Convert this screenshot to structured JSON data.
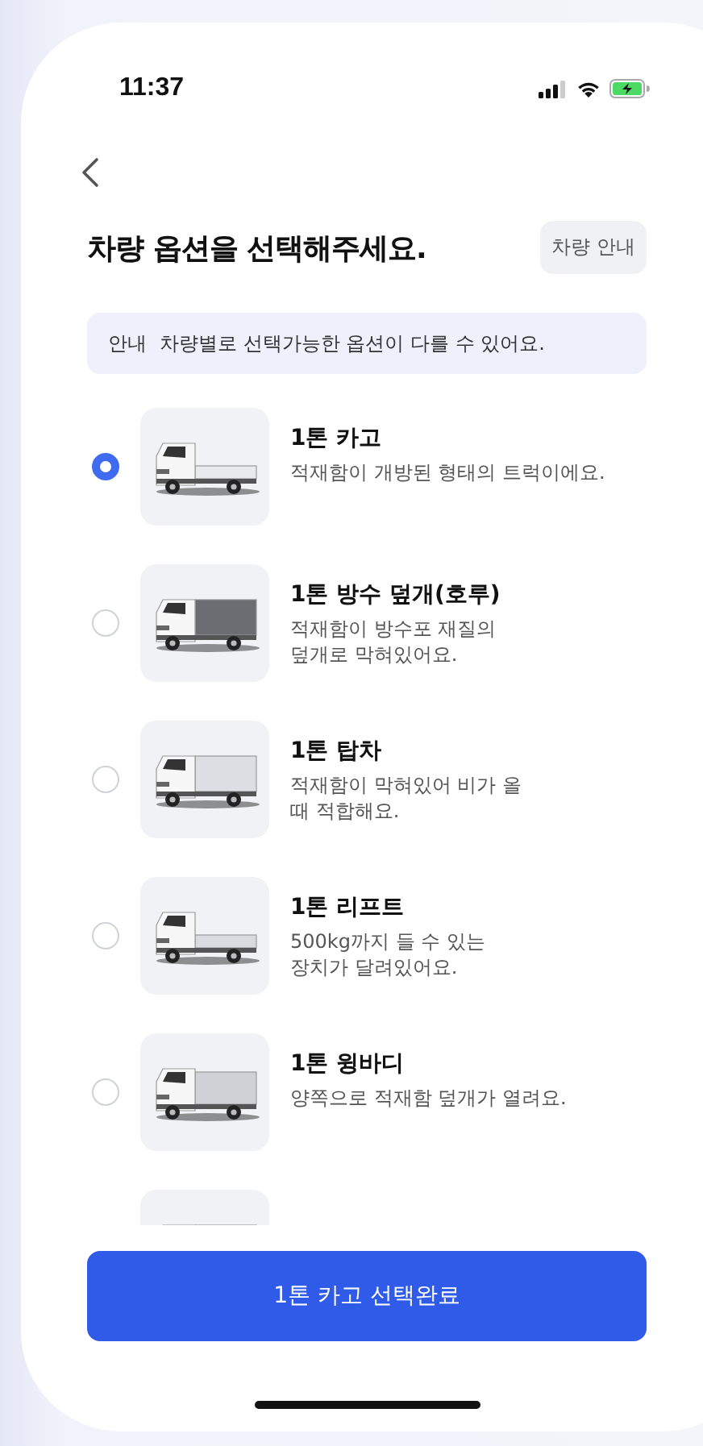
{
  "status_bar": {
    "time": "11:37"
  },
  "header": {
    "title": "차량 옵션을 선택해주세요.",
    "guide_button": "차량 안내"
  },
  "notice": {
    "label": "안내",
    "text": "차량별로 선택가능한 옵션이 다를 수 있어요."
  },
  "options": [
    {
      "title": "1톤 카고",
      "description": "적재함이 개방된 형태의 트럭이에요.",
      "selected": true
    },
    {
      "title": "1톤 방수 덮개(호루)",
      "description": "적재함이 방수포 재질의\n덮개로 막혀있어요.",
      "selected": false
    },
    {
      "title": "1톤 탑차",
      "description": "적재함이 막혀있어 비가 올\n때 적합해요.",
      "selected": false
    },
    {
      "title": "1톤 리프트",
      "description": "500kg까지 들 수 있는\n장치가 달려있어요.",
      "selected": false
    },
    {
      "title": "1톤 윙바디",
      "description": "양쪽으로 적재함 덮개가 열려요.",
      "selected": false
    }
  ],
  "confirm_button": "1톤 카고 선택완료"
}
